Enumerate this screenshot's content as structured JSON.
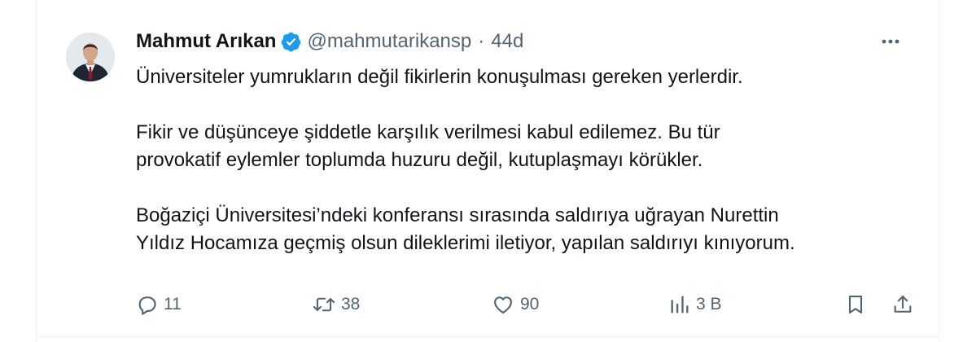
{
  "author": {
    "display_name": "Mahmut Arıkan",
    "verified_icon": "verified-badge-icon",
    "handle": "@mahmutarikansp",
    "separator": "·",
    "timestamp": "44d"
  },
  "tweet": {
    "paragraphs": [
      "Üniversiteler yumrukların değil fikirlerin konuşulması gereken yerlerdir.",
      "Fikir ve düşünceye şiddetle karşılık verilmesi kabul edilemez. Bu tür",
      "provokatif eylemler toplumda huzuru değil, kutuplaşmayı körükler.",
      "Boğaziçi Üniversitesi’ndeki konferansı sırasında saldırıya uğrayan Nurettin",
      "Yıldız Hocamıza geçmiş olsun dileklerimi iletiyor, yapılan saldırıyı kınıyorum."
    ]
  },
  "actions": {
    "reply_count": "11",
    "retweet_count": "38",
    "like_count": "90",
    "views_count": "3 B"
  },
  "colors": {
    "accent": "#1d9bf0",
    "text_primary": "#0f1419",
    "text_secondary": "#536471",
    "border": "#eff3f4"
  }
}
